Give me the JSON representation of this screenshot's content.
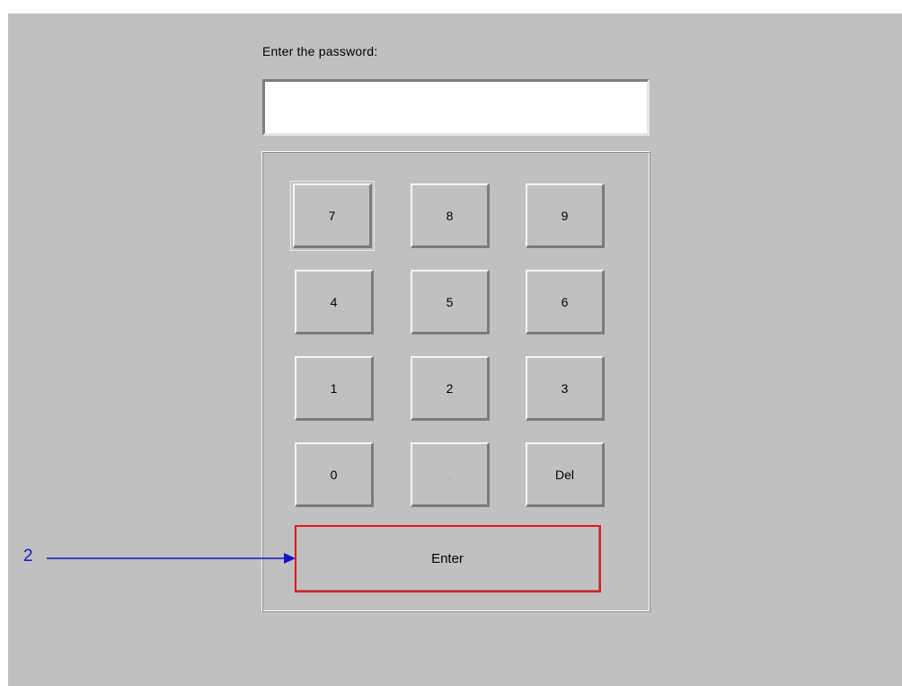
{
  "prompt": {
    "label": "Enter the password:"
  },
  "password_field": {
    "value": "",
    "placeholder": ""
  },
  "keypad": {
    "keys": [
      "7",
      "8",
      "9",
      "4",
      "5",
      "6",
      "1",
      "2",
      "3",
      "0",
      ".",
      "Del"
    ],
    "enter_label": "Enter"
  },
  "annotation": {
    "number": "2",
    "color": "#1414c8",
    "highlight_color": "#e8141c"
  }
}
